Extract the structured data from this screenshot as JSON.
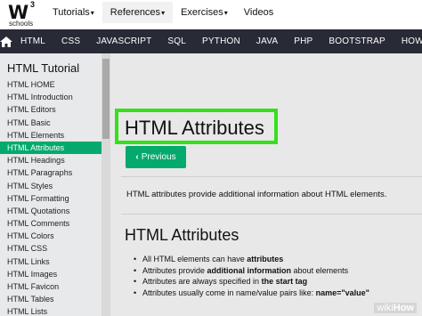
{
  "logo": {
    "mark": "W",
    "sup": "3",
    "sub": "schools"
  },
  "topnav": [
    {
      "label": "Tutorials",
      "caret": "▾"
    },
    {
      "label": "References",
      "caret": "▾"
    },
    {
      "label": "Exercises",
      "caret": "▾"
    },
    {
      "label": "Videos",
      "caret": ""
    }
  ],
  "darknav": [
    "HTML",
    "CSS",
    "JAVASCRIPT",
    "SQL",
    "PYTHON",
    "JAVA",
    "PHP",
    "BOOTSTRAP",
    "HOW TO"
  ],
  "sidebar": {
    "title": "HTML Tutorial",
    "items": [
      "HTML HOME",
      "HTML Introduction",
      "HTML Editors",
      "HTML Basic",
      "HTML Elements",
      "HTML Attributes",
      "HTML Headings",
      "HTML Paragraphs",
      "HTML Styles",
      "HTML Formatting",
      "HTML Quotations",
      "HTML Comments",
      "HTML Colors",
      "HTML CSS",
      "HTML Links",
      "HTML Images",
      "HTML Favicon",
      "HTML Tables",
      "HTML Lists"
    ],
    "active_index": 5
  },
  "main": {
    "title": "HTML Attributes",
    "prev_label": "Previous",
    "prev_chevron": "‹",
    "intro": "HTML attributes provide additional information about HTML elements.",
    "h2": "HTML Attributes",
    "bullets": [
      {
        "pre": "All HTML elements can have ",
        "bold": "attributes",
        "post": ""
      },
      {
        "pre": "Attributes provide ",
        "bold": "additional information",
        "post": " about elements"
      },
      {
        "pre": "Attributes are always specified in ",
        "bold": "the start tag",
        "post": ""
      },
      {
        "pre": "Attributes usually come in name/value pairs like: ",
        "bold": "name=\"value\"",
        "post": ""
      }
    ]
  },
  "watermark": {
    "w1": "wiki",
    "w2": "How"
  },
  "colors": {
    "accent": "#04aa6d",
    "highlight_box": "#35e01a",
    "darknav": "#282a35"
  }
}
